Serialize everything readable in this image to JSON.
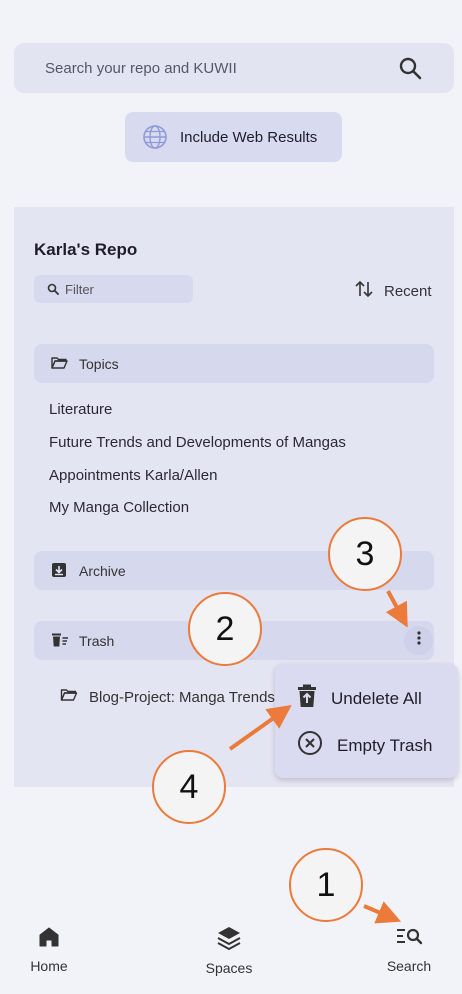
{
  "search": {
    "placeholder": "Search your repo and KUWII"
  },
  "web_results_label": "Include Web Results",
  "repo": {
    "title": "Karla's Repo",
    "filter_label": "Filter",
    "sort_label": "Recent",
    "sections": {
      "topics": "Topics",
      "archive": "Archive",
      "trash": "Trash"
    },
    "topics": [
      "Literature",
      "Future Trends and Developments of Mangas",
      "Appointments Karla/Allen",
      "My Manga Collection"
    ],
    "trash_items": [
      "Blog-Project: Manga Trends"
    ]
  },
  "context_menu": {
    "undelete_all": "Undelete All",
    "empty_trash": "Empty Trash"
  },
  "annotations": [
    "1",
    "2",
    "3",
    "4"
  ],
  "bottom_nav": {
    "home": "Home",
    "spaces": "Spaces",
    "search": "Search"
  },
  "colors": {
    "accent": "#ec7a3a",
    "surface": "#e4e5f3",
    "background": "#f2f2f9"
  }
}
